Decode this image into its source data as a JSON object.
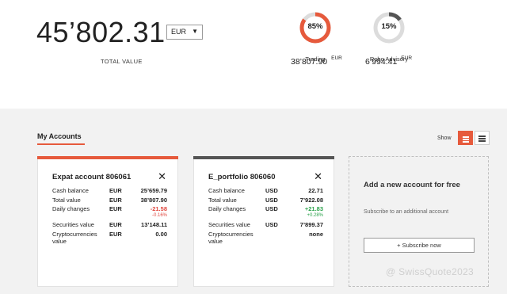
{
  "summary": {
    "total_value": "45’802.31",
    "currency": "EUR",
    "total_label": "TOTAL VALUE"
  },
  "allocations": [
    {
      "label": "Trading",
      "percent_label": "85%",
      "fraction": 0.85,
      "amount": "38’807.90",
      "currency": "EUR",
      "color": "#e65a3c"
    },
    {
      "label": "Robo Advisory",
      "percent_label": "15%",
      "fraction": 0.15,
      "amount": "6’994.41",
      "currency": "EUR",
      "color": "#555555"
    }
  ],
  "accounts": {
    "title": "My Accounts",
    "show_label": "Show",
    "cards": [
      {
        "title": "Expat account 806061",
        "accent": "#e65a3c",
        "rows": [
          {
            "label": "Cash balance",
            "currency": "EUR",
            "value": "25’659.79"
          },
          {
            "label": "Total value",
            "currency": "EUR",
            "value": "38’807.90"
          },
          {
            "label": "Daily changes",
            "currency": "EUR",
            "value": "-21.58",
            "sub": "-0.16%"
          },
          {
            "label": "Securities value",
            "currency": "EUR",
            "value": "13’148.11"
          },
          {
            "label": "Cryptocurrencies value",
            "currency": "EUR",
            "value": "0.00"
          }
        ]
      },
      {
        "title": "E_portfolio 806060",
        "accent": "#555555",
        "rows": [
          {
            "label": "Cash balance",
            "currency": "USD",
            "value": "22.71"
          },
          {
            "label": "Total value",
            "currency": "USD",
            "value": "7’922.08"
          },
          {
            "label": "Daily changes",
            "currency": "USD",
            "value": "+21.83",
            "sub": "+0.28%"
          },
          {
            "label": "Securities value",
            "currency": "USD",
            "value": "7’899.37"
          },
          {
            "label": "Cryptocurrencies value",
            "currency": "",
            "value": "none"
          }
        ]
      }
    ],
    "add_card": {
      "title": "Add a new account for free",
      "subtitle": "Subscribe to an additional account",
      "button_label": "+ Subscribe now"
    }
  },
  "watermark": "@ SwissQuote2023",
  "icons": {
    "close": "close-icon",
    "grid_view": "grid-view-icon",
    "list_view": "list-view-icon",
    "caret": "caret-down-icon"
  }
}
